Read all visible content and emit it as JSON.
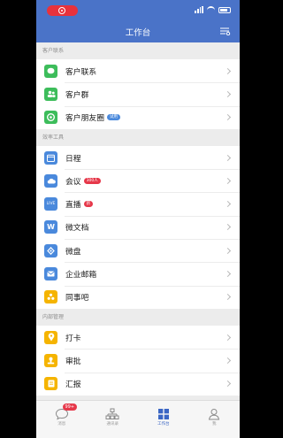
{
  "header": {
    "title": "工作台"
  },
  "sections": [
    {
      "title": "客户联系",
      "items": [
        {
          "label": "客户联系",
          "icon": "wechat-contact-icon",
          "color": "#3dbd5b"
        },
        {
          "label": "客户群",
          "icon": "customer-group-icon",
          "color": "#3dbd5b"
        },
        {
          "label": "客户朋友圈",
          "icon": "moments-icon",
          "color": "#3dbd5b",
          "tag": "试用",
          "tag_color": "blue"
        }
      ]
    },
    {
      "title": "效率工具",
      "items": [
        {
          "label": "日程",
          "icon": "calendar-icon",
          "color": "#4a89dc"
        },
        {
          "label": "会议",
          "icon": "meeting-cloud-icon",
          "color": "#4a89dc",
          "tag": "300人",
          "tag_color": "red"
        },
        {
          "label": "直播",
          "icon": "live-icon",
          "color": "#4a89dc",
          "icon_text": "LIVE",
          "tag": "新",
          "tag_color": "red"
        },
        {
          "label": "微文档",
          "icon": "document-icon",
          "color": "#4a89dc",
          "icon_text": "W"
        },
        {
          "label": "微盘",
          "icon": "drive-icon",
          "color": "#4a89dc"
        },
        {
          "label": "企业邮箱",
          "icon": "mail-icon",
          "color": "#4a89dc"
        },
        {
          "label": "同事吧",
          "icon": "colleague-icon",
          "color": "#f5b400"
        }
      ]
    },
    {
      "title": "内部管理",
      "items": [
        {
          "label": "打卡",
          "icon": "checkin-pin-icon",
          "color": "#f5b400"
        },
        {
          "label": "审批",
          "icon": "approval-icon",
          "color": "#f5b400"
        },
        {
          "label": "汇报",
          "icon": "report-icon",
          "color": "#f5b400"
        }
      ]
    }
  ],
  "tabbar": {
    "active": 2,
    "items": [
      {
        "label": "消息",
        "icon": "message-icon",
        "badge": "99+"
      },
      {
        "label": "通讯录",
        "icon": "contacts-icon"
      },
      {
        "label": "工作台",
        "icon": "workbench-icon"
      },
      {
        "label": "我",
        "icon": "me-icon"
      }
    ]
  }
}
